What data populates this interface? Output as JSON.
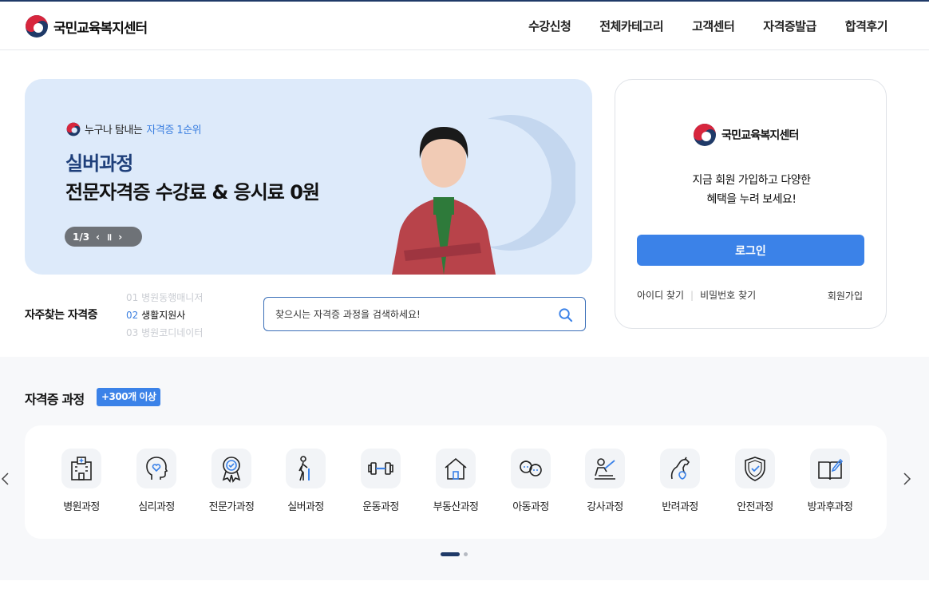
{
  "header": {
    "logo_text": "국민교육복지센터",
    "nav": [
      "수강신청",
      "전체카테고리",
      "고객센터",
      "자격증발급",
      "합격후기"
    ]
  },
  "banner": {
    "sub_prefix": "누구나 탐내는",
    "sub_highlight": "자격증 1순위",
    "title1": "실버과정",
    "title2": "전문자격증 수강료 & 응시료 0원",
    "pager": "1/3"
  },
  "login": {
    "logo_text": "국민교육복지센터",
    "msg_line1": "지금 회원 가입하고 다양한",
    "msg_line2": "혜택을 누려 보세요!",
    "button": "로그인",
    "find_id": "아이디 찾기",
    "find_pw": "비밀번호 찾기",
    "signup": "회원가입"
  },
  "frequent": {
    "label": "자주찾는 자격증",
    "items": [
      {
        "num": "01",
        "name": "병원동행매니저"
      },
      {
        "num": "02",
        "name": "생활지원사"
      },
      {
        "num": "03",
        "name": "병원코디네이터"
      }
    ]
  },
  "search": {
    "placeholder": "찾으시는 자격증 과정을 검색하세요!"
  },
  "courses": {
    "title": "자격증 과정",
    "badge": "+300개 이상",
    "items": [
      {
        "label": "병원과정",
        "icon": "hospital-icon"
      },
      {
        "label": "심리과정",
        "icon": "mind-icon"
      },
      {
        "label": "전문가과정",
        "icon": "award-icon"
      },
      {
        "label": "실버과정",
        "icon": "elder-icon"
      },
      {
        "label": "운동과정",
        "icon": "dumbbell-icon"
      },
      {
        "label": "부동산과정",
        "icon": "house-icon"
      },
      {
        "label": "아동과정",
        "icon": "children-icon"
      },
      {
        "label": "강사과정",
        "icon": "teacher-icon"
      },
      {
        "label": "반려과정",
        "icon": "pet-icon"
      },
      {
        "label": "안전과정",
        "icon": "shield-icon"
      },
      {
        "label": "방과후과정",
        "icon": "book-icon"
      }
    ]
  },
  "colors": {
    "accent": "#3b82e8",
    "navy": "#1f3a68",
    "banner_bg": "#ddeafa"
  }
}
